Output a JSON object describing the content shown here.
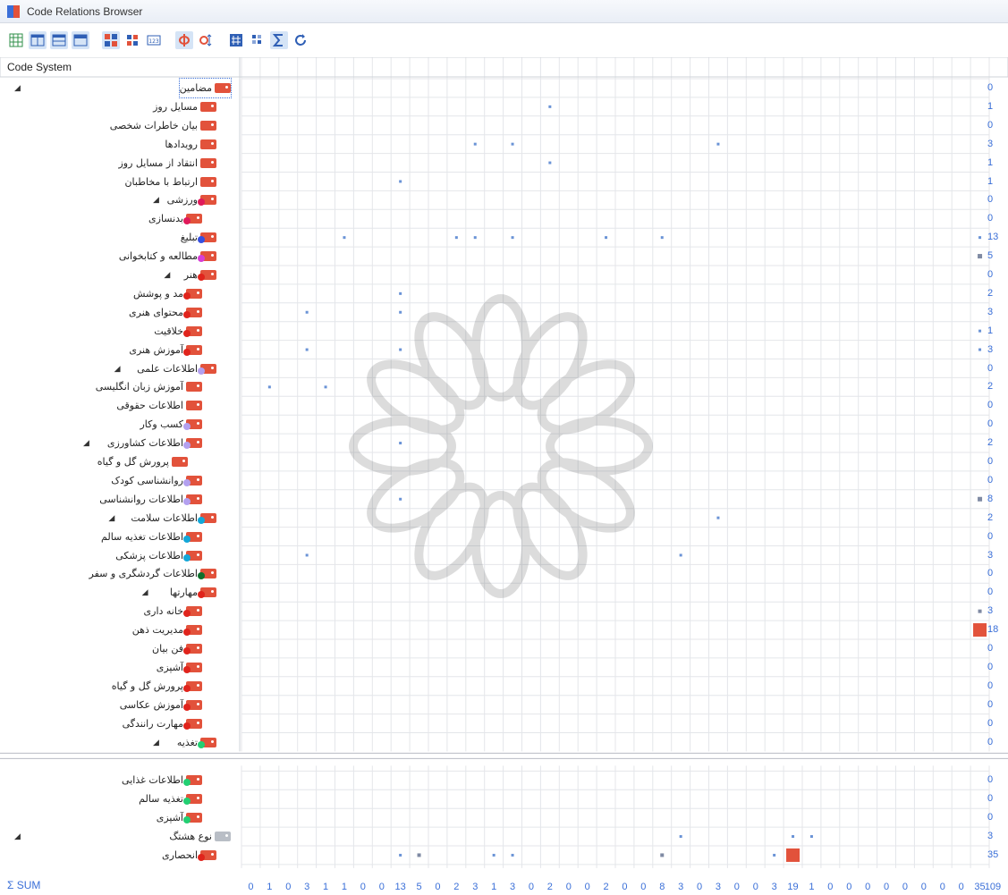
{
  "window": {
    "title": "Code Relations Browser"
  },
  "header": {
    "code_system": "Code System"
  },
  "colors": {
    "red": "#e2523b",
    "blue": "#3a6fd8",
    "grid": "#e4e6ea"
  },
  "toolbar": {
    "items": [
      {
        "name": "grid-view-icon",
        "on": false
      },
      {
        "name": "layout-columns-icon",
        "on": true
      },
      {
        "name": "layout-rows-icon",
        "on": true
      },
      {
        "name": "layout-panel-icon",
        "on": true
      },
      {
        "name": "squares-icon",
        "on": true
      },
      {
        "name": "squares-alt-icon",
        "on": false
      },
      {
        "name": "numbers-123-icon",
        "on": false
      },
      {
        "name": "relations-icon",
        "on": true
      },
      {
        "name": "relations-sort-icon",
        "on": false
      },
      {
        "name": "hash-icon",
        "on": false
      },
      {
        "name": "tiles-icon",
        "on": false
      },
      {
        "name": "sum-icon",
        "on": true
      },
      {
        "name": "refresh-icon",
        "on": false
      }
    ]
  },
  "rows": [
    {
      "label": "مضامین",
      "indent": 0,
      "expand": true,
      "tagColor": "#e2523b",
      "dot": null,
      "count": "0",
      "sel": true
    },
    {
      "label": "مسایل روز",
      "indent": 1,
      "expand": false,
      "tagColor": "#e2523b",
      "dot": null,
      "count": "1"
    },
    {
      "label": "بیان خاطرات شخصی",
      "indent": 1,
      "expand": false,
      "tagColor": "#e2523b",
      "dot": null,
      "count": "0"
    },
    {
      "label": "رویدادها",
      "indent": 1,
      "expand": false,
      "tagColor": "#e2523b",
      "dot": null,
      "count": "3"
    },
    {
      "label": "انتقاد از مسایل روز",
      "indent": 1,
      "expand": false,
      "tagColor": "#e2523b",
      "dot": null,
      "count": "1"
    },
    {
      "label": "ارتباط با مخاطبان",
      "indent": 1,
      "expand": false,
      "tagColor": "#e2523b",
      "dot": null,
      "count": "1"
    },
    {
      "label": "ورزشی",
      "indent": 1,
      "expand": true,
      "tagColor": "#e2523b",
      "dot": "#e01a5a",
      "count": "0"
    },
    {
      "label": "بدنسازی",
      "indent": 2,
      "expand": false,
      "tagColor": "#e2523b",
      "dot": "#e01a5a",
      "count": "0"
    },
    {
      "label": "تبلیغ",
      "indent": 1,
      "expand": false,
      "tagColor": "#e2523b",
      "dot": "#3650e0",
      "count": "13"
    },
    {
      "label": "مطالعه و کتابخوانی",
      "indent": 1,
      "expand": false,
      "tagColor": "#e2523b",
      "dot": "#d63ed6",
      "count": "5"
    },
    {
      "label": "هنر",
      "indent": 1,
      "expand": true,
      "tagColor": "#e2523b",
      "dot": "#e0241c",
      "count": "0"
    },
    {
      "label": "مد و پوشش",
      "indent": 2,
      "expand": false,
      "tagColor": "#e2523b",
      "dot": "#e0241c",
      "count": "2"
    },
    {
      "label": "محتوای هنری",
      "indent": 2,
      "expand": false,
      "tagColor": "#e2523b",
      "dot": "#e0241c",
      "count": "3"
    },
    {
      "label": "خلاقیت",
      "indent": 2,
      "expand": false,
      "tagColor": "#e2523b",
      "dot": "#e0241c",
      "count": "1"
    },
    {
      "label": "آموزش هنری",
      "indent": 2,
      "expand": false,
      "tagColor": "#e2523b",
      "dot": "#e0241c",
      "count": "3"
    },
    {
      "label": "اطلاعات علمی",
      "indent": 1,
      "expand": true,
      "tagColor": "#e2523b",
      "dot": "#b3a0ef",
      "count": "0"
    },
    {
      "label": "آموزش زبان انگلیسی",
      "indent": 2,
      "expand": false,
      "tagColor": "#e2523b",
      "dot": null,
      "count": "2"
    },
    {
      "label": "اطلاعات حقوقی",
      "indent": 2,
      "expand": false,
      "tagColor": "#e2523b",
      "dot": null,
      "count": "0"
    },
    {
      "label": "کسب وکار",
      "indent": 2,
      "expand": false,
      "tagColor": "#e2523b",
      "dot": "#b3a0ef",
      "count": "0"
    },
    {
      "label": "اطلاعات کشاورزی",
      "indent": 2,
      "expand": true,
      "tagColor": "#e2523b",
      "dot": "#b3a0ef",
      "count": "2"
    },
    {
      "label": "پرورش گل و گیاه",
      "indent": 3,
      "expand": false,
      "tagColor": "#e2523b",
      "dot": null,
      "count": "0"
    },
    {
      "label": "روانشناسی کودک",
      "indent": 2,
      "expand": false,
      "tagColor": "#e2523b",
      "dot": "#b3a0ef",
      "count": "0"
    },
    {
      "label": "اطلاعات روانشناسی",
      "indent": 2,
      "expand": false,
      "tagColor": "#e2523b",
      "dot": "#b3a0ef",
      "count": "8"
    },
    {
      "label": "اطلاعات سلامت",
      "indent": 1,
      "expand": true,
      "tagColor": "#e2523b",
      "dot": "#13a7d8",
      "count": "2"
    },
    {
      "label": "اطلاعات تغذیه سالم",
      "indent": 2,
      "expand": false,
      "tagColor": "#e2523b",
      "dot": "#13a7d8",
      "count": "0"
    },
    {
      "label": "اطلاعات پزشکی",
      "indent": 2,
      "expand": false,
      "tagColor": "#e2523b",
      "dot": "#13a7d8",
      "count": "3"
    },
    {
      "label": "اطلاعات گردشگری و سفر",
      "indent": 1,
      "expand": false,
      "tagColor": "#e2523b",
      "dot": "#0e6f2d",
      "count": "0"
    },
    {
      "label": "مهارتها",
      "indent": 1,
      "expand": true,
      "tagColor": "#e2523b",
      "dot": "#e0241c",
      "count": "0"
    },
    {
      "label": "خانه داری",
      "indent": 2,
      "expand": false,
      "tagColor": "#e2523b",
      "dot": "#e0241c",
      "count": "3"
    },
    {
      "label": "مدیریت ذهن",
      "indent": 2,
      "expand": false,
      "tagColor": "#e2523b",
      "dot": "#e0241c",
      "count": "18"
    },
    {
      "label": "فن بیان",
      "indent": 2,
      "expand": false,
      "tagColor": "#e2523b",
      "dot": "#e0241c",
      "count": "0"
    },
    {
      "label": "آشپزی",
      "indent": 2,
      "expand": false,
      "tagColor": "#e2523b",
      "dot": "#e0241c",
      "count": "0"
    },
    {
      "label": "پرورش گل و گیاه",
      "indent": 2,
      "expand": false,
      "tagColor": "#e2523b",
      "dot": "#e0241c",
      "count": "0"
    },
    {
      "label": "آموزش عکاسی",
      "indent": 2,
      "expand": false,
      "tagColor": "#e2523b",
      "dot": "#e0241c",
      "count": "0"
    },
    {
      "label": "مهارت رانندگی",
      "indent": 2,
      "expand": false,
      "tagColor": "#e2523b",
      "dot": "#e0241c",
      "count": "0"
    },
    {
      "label": "تغذیه",
      "indent": 1,
      "expand": true,
      "tagColor": "#e2523b",
      "dot": "#22cf72",
      "count": "0"
    },
    {
      "label": "اطلاعات غذایی",
      "indent": 2,
      "expand": false,
      "tagColor": "#e2523b",
      "dot": "#22cf72",
      "count": "0",
      "gap": true
    },
    {
      "label": "تغذیه سالم",
      "indent": 2,
      "expand": false,
      "tagColor": "#e2523b",
      "dot": "#22cf72",
      "count": "0"
    },
    {
      "label": "آشپزی",
      "indent": 2,
      "expand": false,
      "tagColor": "#e2523b",
      "dot": "#22cf72",
      "count": "0"
    },
    {
      "label": "نوع هشتگ",
      "indent": 0,
      "expand": true,
      "tagColor": "#b9bec6",
      "dot": null,
      "count": "3"
    },
    {
      "label": "انحصاری",
      "indent": 1,
      "expand": false,
      "tagColor": "#e2523b",
      "dot": "#e0241c",
      "count": "35"
    }
  ],
  "sum": {
    "label": "SUM",
    "values": [
      "0",
      "1",
      "0",
      "3",
      "1",
      "1",
      "0",
      "0",
      "13",
      "5",
      "0",
      "2",
      "3",
      "1",
      "3",
      "0",
      "2",
      "0",
      "0",
      "2",
      "0",
      "0",
      "8",
      "3",
      "0",
      "3",
      "0",
      "0",
      "3",
      "19",
      "1",
      "0",
      "0",
      "0",
      "0",
      "0",
      "0",
      "0",
      "0",
      "35",
      "109"
    ]
  },
  "chart_data": {
    "type": "heatmap",
    "marks": [
      {
        "row": 1,
        "col": 16,
        "v": 1
      },
      {
        "row": 3,
        "col": 12,
        "v": 1
      },
      {
        "row": 3,
        "col": 14,
        "v": 1
      },
      {
        "row": 3,
        "col": 25,
        "v": 1
      },
      {
        "row": 4,
        "col": 16,
        "v": 1
      },
      {
        "row": 5,
        "col": 8,
        "v": 1
      },
      {
        "row": 8,
        "col": 5,
        "v": 1
      },
      {
        "row": 8,
        "col": 11,
        "v": 1
      },
      {
        "row": 8,
        "col": 12,
        "v": 1
      },
      {
        "row": 8,
        "col": 14,
        "v": 1
      },
      {
        "row": 8,
        "col": 19,
        "v": 1
      },
      {
        "row": 8,
        "col": 22,
        "v": 1
      },
      {
        "row": 8,
        "col": 39,
        "v": 1
      },
      {
        "row": 9,
        "col": 39,
        "v": 5
      },
      {
        "row": 11,
        "col": 8,
        "v": 2
      },
      {
        "row": 12,
        "col": 3,
        "v": 1
      },
      {
        "row": 12,
        "col": 8,
        "v": 2
      },
      {
        "row": 13,
        "col": 39,
        "v": 1
      },
      {
        "row": 14,
        "col": 3,
        "v": 1
      },
      {
        "row": 14,
        "col": 8,
        "v": 1
      },
      {
        "row": 14,
        "col": 39,
        "v": 1
      },
      {
        "row": 16,
        "col": 1,
        "v": 1
      },
      {
        "row": 16,
        "col": 4,
        "v": 1
      },
      {
        "row": 19,
        "col": 8,
        "v": 2
      },
      {
        "row": 22,
        "col": 8,
        "v": 1
      },
      {
        "row": 22,
        "col": 39,
        "v": 7
      },
      {
        "row": 23,
        "col": 25,
        "v": 2
      },
      {
        "row": 25,
        "col": 3,
        "v": 1
      },
      {
        "row": 25,
        "col": 23,
        "v": 2
      },
      {
        "row": 28,
        "col": 39,
        "v": 3
      },
      {
        "row": 29,
        "col": 39,
        "v": 18
      },
      {
        "row": 39,
        "col": 23,
        "v": 1
      },
      {
        "row": 39,
        "col": 29,
        "v": 1
      },
      {
        "row": 39,
        "col": 30,
        "v": 1
      },
      {
        "row": 40,
        "col": 8,
        "v": 1
      },
      {
        "row": 40,
        "col": 9,
        "v": 3
      },
      {
        "row": 40,
        "col": 13,
        "v": 1
      },
      {
        "row": 40,
        "col": 14,
        "v": 1
      },
      {
        "row": 40,
        "col": 22,
        "v": 3
      },
      {
        "row": 40,
        "col": 28,
        "v": 1
      },
      {
        "row": 40,
        "col": 29,
        "v": 17
      }
    ]
  }
}
